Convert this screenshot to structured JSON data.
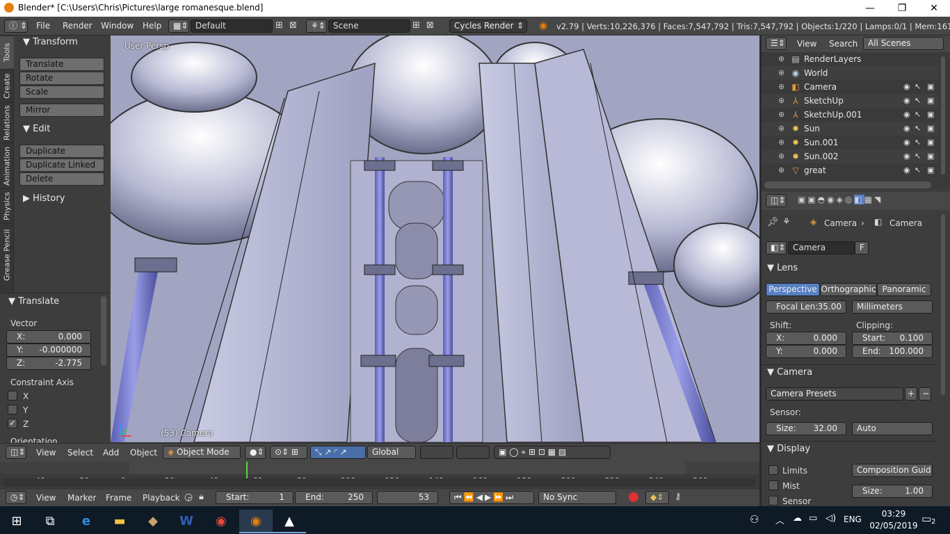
{
  "window": {
    "title": "Blender* [C:\\Users\\Chris\\Pictures\\large romanesque.blend]"
  },
  "infobar": {
    "menus": [
      "File",
      "Render",
      "Window",
      "Help"
    ],
    "layout": "Default",
    "scene": "Scene",
    "engine": "Cycles Render",
    "stats": "v2.79 | Verts:10,226,376 | Faces:7,547,792 | Tris:7,547,792 | Objects:1/220 | Lamps:0/1 | Mem:1618.95M"
  },
  "tabs": [
    "Tools",
    "Create",
    "Relations",
    "Animation",
    "Physics",
    "Grease Pencil"
  ],
  "toolshelf": {
    "transform_header": "Transform",
    "transform_buttons": [
      "Translate",
      "Rotate",
      "Scale"
    ],
    "mirror": "Mirror",
    "edit_header": "Edit",
    "edit_buttons": [
      "Duplicate",
      "Duplicate Linked",
      "Delete"
    ],
    "history_header": "History"
  },
  "operator": {
    "header": "Translate",
    "vector_label": "Vector",
    "x_label": "X:",
    "x": "0.000",
    "y_label": "Y:",
    "y": "-0.000000",
    "z_label": "Z:",
    "z": "-2.775",
    "constraint_label": "Constraint Axis",
    "cx": "X",
    "cy": "Y",
    "cz": "Z",
    "orientation": "Orientation"
  },
  "viewport": {
    "view_name": "User Persp",
    "object_label": "(53) Camera"
  },
  "viewport_header": {
    "menus": [
      "View",
      "Select",
      "Add",
      "Object"
    ],
    "mode": "Object Mode",
    "orientation": "Global"
  },
  "timeline": {
    "ticks": [
      "-40",
      "-20",
      "0",
      "20",
      "40",
      "60",
      "80",
      "100",
      "120",
      "140",
      "160",
      "180",
      "200",
      "220",
      "240",
      "260"
    ],
    "menus": [
      "View",
      "Marker",
      "Frame",
      "Playback"
    ],
    "start_label": "Start:",
    "start": "1",
    "end_label": "End:",
    "end": "250",
    "current": "53",
    "sync": "No Sync"
  },
  "outliner": {
    "menus": [
      "View",
      "Search"
    ],
    "filter": "All Scenes",
    "items": [
      {
        "label": "RenderLayers",
        "icon": "render-layers-icon",
        "glyph": "▤",
        "color": "#c8c8c8"
      },
      {
        "label": "World",
        "icon": "world-icon",
        "glyph": "◉",
        "color": "#bcd2e8"
      },
      {
        "label": "Camera",
        "icon": "camera-icon",
        "glyph": "◧",
        "color": "#e39a3f"
      },
      {
        "label": "SketchUp",
        "icon": "empty-icon",
        "glyph": "⅄",
        "color": "#e39a3f"
      },
      {
        "label": "SketchUp.001",
        "icon": "empty-icon",
        "glyph": "⅄",
        "color": "#e39a3f"
      },
      {
        "label": "Sun",
        "icon": "lamp-icon",
        "glyph": "✹",
        "color": "#e8c35a"
      },
      {
        "label": "Sun.001",
        "icon": "lamp-icon",
        "glyph": "✹",
        "color": "#e8c35a"
      },
      {
        "label": "Sun.002",
        "icon": "lamp-icon",
        "glyph": "✹",
        "color": "#e8c35a"
      },
      {
        "label": "great",
        "icon": "mesh-icon",
        "glyph": "▽",
        "color": "#e39a3f"
      }
    ]
  },
  "properties": {
    "breadcrumb": [
      "Camera",
      "Camera"
    ],
    "datablock": "Camera",
    "fake_user": "F",
    "lens_header": "Lens",
    "lens_types": [
      "Perspective",
      "Orthographic",
      "Panoramic"
    ],
    "focal_label": "Focal Len:",
    "focal": "35.00",
    "units": "Millimeters",
    "shift_label": "Shift:",
    "clipping_label": "Clipping:",
    "shift_x_label": "X:",
    "shift_x": "0.000",
    "shift_y_label": "Y:",
    "shift_y": "0.000",
    "clip_start_label": "Start:",
    "clip_start": "0.100",
    "clip_end_label": "End:",
    "clip_end": "100.000",
    "camera_header": "Camera",
    "presets": "Camera Presets",
    "sensor_label": "Sensor:",
    "size_label": "Size:",
    "size": "32.00",
    "fit": "Auto",
    "display_header": "Display",
    "limits": "Limits",
    "composition": "Composition Guid",
    "mist": "Mist",
    "sensor": "Sensor",
    "disp_size_label": "Size:",
    "disp_size": "1.00"
  },
  "taskbar": {
    "time": "03:29",
    "date": "02/05/2019",
    "lang": "ENG",
    "notifications": "2"
  },
  "colors": {
    "accent": "#5680c2",
    "active_blue": "#5680c2",
    "orange": "#e39a3f",
    "frame_line": "#5dd244"
  }
}
